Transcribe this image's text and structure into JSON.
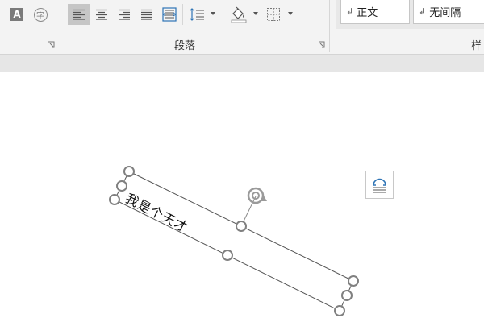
{
  "ribbon": {
    "font_group": {
      "char_shading_glyph": "A",
      "enclose_char_glyph": "字"
    },
    "paragraph_group": {
      "label": "段落"
    },
    "styles_group": {
      "label_partial": "样",
      "style_normal": "正文",
      "style_no_spacing": "无间隔",
      "return_mark": "↲"
    }
  },
  "document": {
    "textbox_text": "我是个天才"
  },
  "colors": {
    "ribbon_bg": "#f3f3f3",
    "active_button": "#c6c6c6",
    "handle_stroke": "#808080",
    "layout_icon": "#2e74b5"
  }
}
